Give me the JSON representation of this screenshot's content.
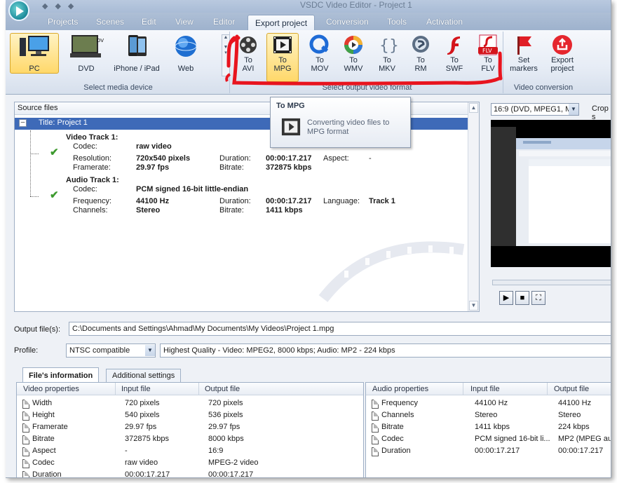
{
  "window": {
    "title": "VSDC Video Editor - Project 1"
  },
  "menu": {
    "tabs": [
      "Projects",
      "Scenes",
      "Edit",
      "View",
      "Editor",
      "Export project",
      "Conversion",
      "Tools",
      "Activation"
    ],
    "active": "Export project"
  },
  "ribbon": {
    "media_devices": {
      "buttons": [
        "PC",
        "DVD",
        "iPhone / iPad",
        "Web"
      ],
      "selected": "PC",
      "label": "Select media device"
    },
    "formats": {
      "buttons": [
        {
          "line1": "To",
          "line2": "AVI"
        },
        {
          "line1": "To",
          "line2": "MPG"
        },
        {
          "line1": "To",
          "line2": "MOV"
        },
        {
          "line1": "To",
          "line2": "WMV"
        },
        {
          "line1": "To",
          "line2": "MKV"
        },
        {
          "line1": "To",
          "line2": "RM"
        },
        {
          "line1": "To",
          "line2": "SWF"
        },
        {
          "line1": "To",
          "line2": "FLV"
        }
      ],
      "selected": "MPG",
      "label": "Select output video format"
    },
    "conversion": {
      "set_markers": {
        "line1": "Set",
        "line2": "markers"
      },
      "export_project": {
        "line1": "Export",
        "line2": "project"
      },
      "label": "Video conversion"
    }
  },
  "tooltip": {
    "title": "To MPG",
    "text": "Converting video files to MPG format"
  },
  "source": {
    "header": "Source files",
    "title_row": "Title: Project 1",
    "video_track": {
      "name": "Video Track 1:",
      "codec_label": "Codec:",
      "codec": "raw video",
      "resolution_label": "Resolution:",
      "resolution": "720x540 pixels",
      "framerate_label": "Framerate:",
      "framerate": "29.97 fps",
      "duration_label": "Duration:",
      "duration": "00:00:17.217",
      "bitrate_label": "Bitrate:",
      "bitrate": "372875 kbps",
      "aspect_label": "Aspect:",
      "aspect": "-"
    },
    "audio_track": {
      "name": "Audio Track 1:",
      "codec_label": "Codec:",
      "codec": "PCM signed 16-bit little-endian",
      "frequency_label": "Frequency:",
      "frequency": "44100 Hz",
      "channels_label": "Channels:",
      "channels": "Stereo",
      "duration_label": "Duration:",
      "duration": "00:00:17.217",
      "bitrate_label": "Bitrate:",
      "bitrate": "1411 kbps",
      "language_label": "Language:",
      "language": "Track 1"
    }
  },
  "preview": {
    "aspect": "16:9 (DVD, MPEG1, M",
    "crop_label": "Crop s"
  },
  "output": {
    "label": "Output file(s):",
    "path": "C:\\Documents and Settings\\Ahmad\\My Documents\\My Videos\\Project 1.mpg",
    "profile_label": "Profile:",
    "profile": "NTSC compatible",
    "profile_desc": "Highest Quality - Video: MPEG2, 8000 kbps; Audio: MP2 - 224 kbps"
  },
  "info_tabs": [
    "File's information",
    "Additional settings"
  ],
  "video_props": {
    "headers": [
      "Video properties",
      "Input file",
      "Output file"
    ],
    "rows": [
      [
        "Width",
        "720 pixels",
        "720 pixels"
      ],
      [
        "Height",
        "540 pixels",
        "536 pixels"
      ],
      [
        "Framerate",
        "29.97 fps",
        "29.97 fps"
      ],
      [
        "Bitrate",
        "372875 kbps",
        "8000 kbps"
      ],
      [
        "Aspect",
        "-",
        "16:9"
      ],
      [
        "Codec",
        "raw video",
        "MPEG-2 video"
      ],
      [
        "Duration",
        "00:00:17.217",
        "00:00:17.217"
      ]
    ]
  },
  "audio_props": {
    "headers": [
      "Audio properties",
      "Input file",
      "Output file"
    ],
    "rows": [
      [
        "Frequency",
        "44100 Hz",
        "44100 Hz"
      ],
      [
        "Channels",
        "Stereo",
        "Stereo"
      ],
      [
        "Bitrate",
        "1411 kbps",
        "224 kbps"
      ],
      [
        "Codec",
        "PCM signed 16-bit li...",
        "MP2 (MPEG audio"
      ],
      [
        "Duration",
        "00:00:17.217",
        "00:00:17.217"
      ]
    ]
  },
  "colors": {
    "selection": "#3e6ab8",
    "annotation": "#e8141e",
    "ribbon_selected": "#ffd86a"
  }
}
